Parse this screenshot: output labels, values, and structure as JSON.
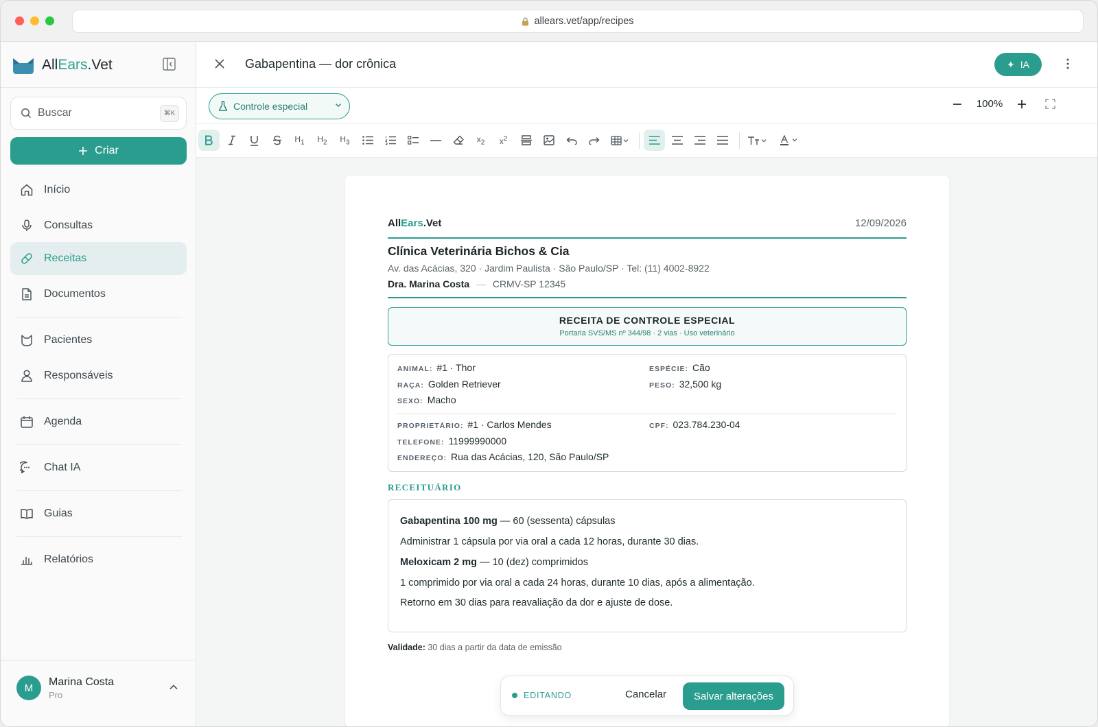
{
  "browser": {
    "url": "allears.vet/app/recipes"
  },
  "brand": {
    "part1": "All",
    "part2": "Ears",
    "part3": ".Vet"
  },
  "sidebar": {
    "search_placeholder": "Buscar",
    "search_shortcut": "⌘K",
    "create_label": "Criar",
    "items": [
      {
        "label": "Início",
        "icon": "home-icon"
      },
      {
        "label": "Consultas",
        "icon": "microphone-icon"
      },
      {
        "label": "Receitas",
        "icon": "pill-icon",
        "active": true
      },
      {
        "label": "Documentos",
        "icon": "document-icon"
      },
      {
        "label": "Pacientes",
        "icon": "cat-icon"
      },
      {
        "label": "Responsáveis",
        "icon": "person-icon"
      },
      {
        "label": "Agenda",
        "icon": "calendar-icon"
      },
      {
        "label": "Chat IA",
        "icon": "chat-icon"
      },
      {
        "label": "Guias",
        "icon": "book-icon"
      },
      {
        "label": "Relatórios",
        "icon": "bar-chart-icon"
      }
    ],
    "user": {
      "initial": "M",
      "name": "Marina Costa",
      "plan": "Pro"
    }
  },
  "header": {
    "title": "Gabapentina — dor crônica",
    "ai_button": "IA"
  },
  "toolbar": {
    "template_select": "Controle especial",
    "zoom": "100%",
    "format_buttons": [
      "bold",
      "italic",
      "underline",
      "strikethrough",
      "H1",
      "H2",
      "H3",
      "bullet-list",
      "ordered-list",
      "checklist",
      "horizontal-rule",
      "clear-format",
      "subscript",
      "superscript",
      "page-break",
      "image",
      "undo",
      "redo",
      "table",
      "align-left",
      "align-center",
      "align-right",
      "justify",
      "font-size",
      "text-color"
    ]
  },
  "document": {
    "logo": {
      "part1": "All",
      "part2": "Ears",
      "part3": ".Vet"
    },
    "date": "12/09/2026",
    "clinic_name": "Clínica Veterinária Bichos & Cia",
    "address": "Av. das Acácias, 320 · Jardim Paulista · São Paulo/SP  · Tel: (11) 4002-8922",
    "vet_name": "Dra. Marina Costa",
    "vet_sep": "—",
    "vet_crmv": "CRMV-SP 12345",
    "banner_title": "RECEITA DE CONTROLE ESPECIAL",
    "banner_subtitle": "Portaria SVS/MS nº 344/98 · 2 vias · Uso veterinário",
    "animal": {
      "animal_label": "ANIMAL:",
      "animal": "#1 · Thor",
      "especie_label": "ESPÉCIE:",
      "especie": "Cão",
      "raca_label": "RAÇA:",
      "raca": "Golden Retriever",
      "peso_label": "PESO:",
      "peso": "32,500 kg",
      "sexo_label": "SEXO:",
      "sexo": "Macho"
    },
    "owner": {
      "proprietario_label": "PROPRIETÁRIO:",
      "proprietario": "#1 · Carlos Mendes",
      "cpf_label": "CPF:",
      "cpf": "023.784.230-04",
      "telefone_label": "TELEFONE:",
      "telefone": "11999990000",
      "endereco_label": "ENDEREÇO:",
      "endereco": "Rua das Acácias, 120, São Paulo/SP"
    },
    "rx_heading": "RECEITUÁRIO",
    "rx": {
      "drug1_name": "Gabapentina 100 mg",
      "drug1_qty": " — 60 (sessenta) cápsulas",
      "drug1_instr": "Administrar 1 cápsula por via oral a cada 12 horas, durante 30 dias.",
      "drug2_name": "Meloxicam 2 mg",
      "drug2_qty": " — 10 (dez) comprimidos",
      "drug2_instr": "1 comprimido por via oral a cada 24 horas, durante 10 dias, após a alimentação.",
      "note": "Retorno em 30 dias para reavaliação da dor e ajuste de dose."
    },
    "validity_label": "Validade:",
    "validity": " 30 dias a partir da data de emissão"
  },
  "footer": {
    "status": "EDITANDO",
    "cancel": "Cancelar",
    "save": "Salvar alterações"
  },
  "colors": {
    "accent": "#2a9d8f",
    "active_bg": "#e4eeee"
  }
}
